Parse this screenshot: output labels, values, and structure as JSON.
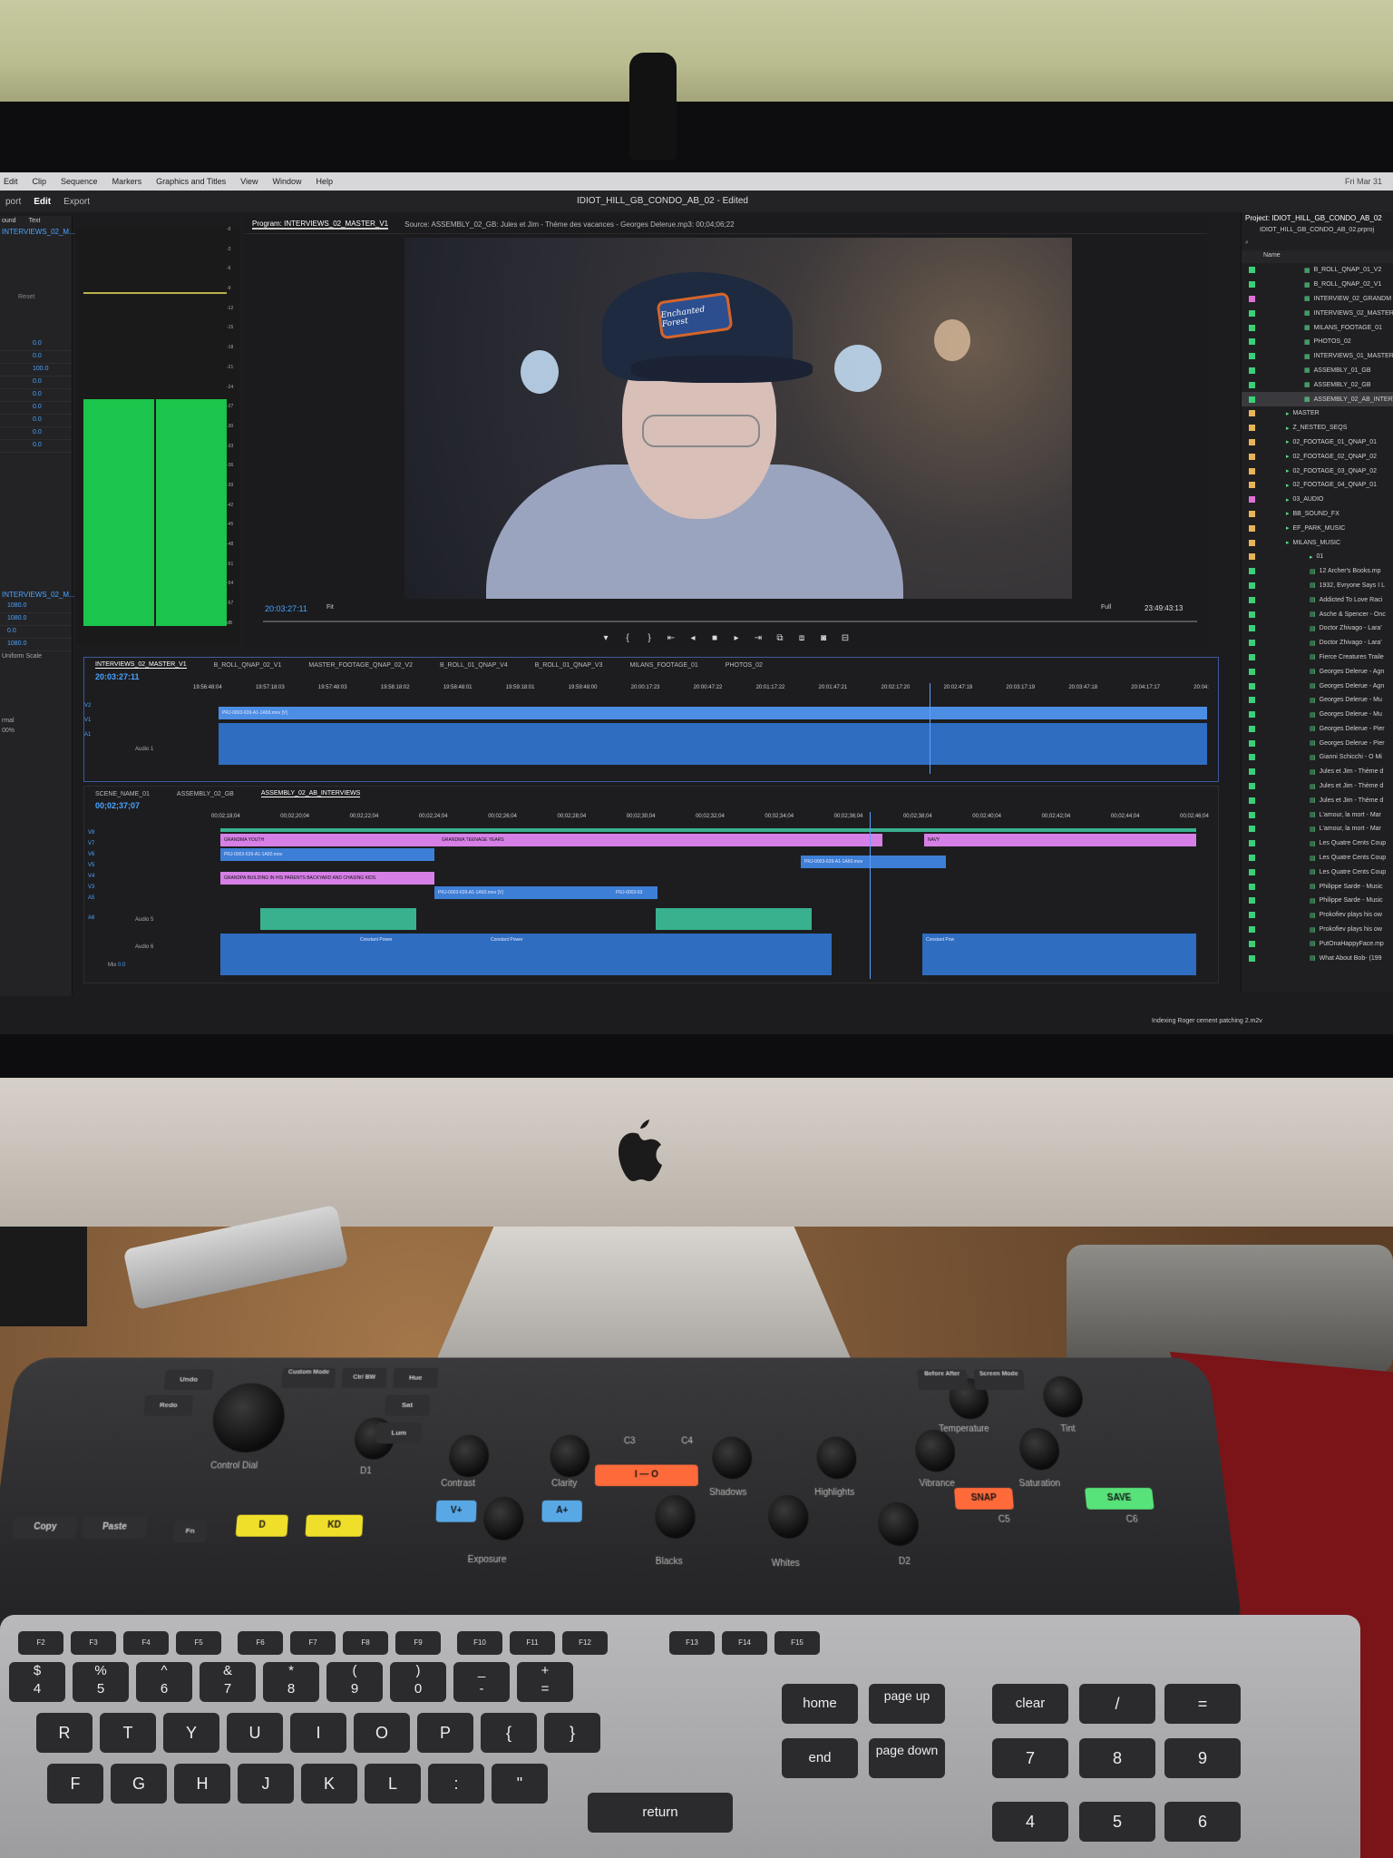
{
  "menu": {
    "items": [
      "Edit",
      "Clip",
      "Sequence",
      "Markers",
      "Graphics and Titles",
      "View",
      "Window",
      "Help"
    ],
    "clock": "Fri Mar 31"
  },
  "workspaces": [
    "port",
    "Edit",
    "Export"
  ],
  "document_title": "IDIOT_HILL_GB_CONDO_AB_02 - Edited",
  "left_panel": {
    "tabs": [
      "ound",
      "Text"
    ],
    "sequence": "INTERVIEWS_02_M...",
    "reset": "Reset",
    "values": [
      "0.0",
      "0.0",
      "100.0",
      "0.0",
      "0.0",
      "0.0",
      "0.0",
      "0.0",
      "0.0"
    ],
    "lower_values": [
      "1080.0",
      "1080.0",
      "0.0",
      "1080.0"
    ],
    "uniform_scale": "Uniform Scale",
    "mode": "rmal",
    "zoom": "00%"
  },
  "meter_scale": [
    "-0",
    "-3",
    "-6",
    "-9",
    "-12",
    "-15",
    "-18",
    "-21",
    "-24",
    "-27",
    "-30",
    "-33",
    "-36",
    "-39",
    "-42",
    "-45",
    "-48",
    "-51",
    "-54",
    "-57",
    "dB"
  ],
  "program": {
    "tab_program": "Program: INTERVIEWS_02_MASTER_V1",
    "tab_source": "Source: ASSEMBLY_02_GB: Jules et Jim - Thème des vacances - Georges Delerue.mp3: 00;04;06;22",
    "timecode_left": "20:03:27:11",
    "fit": "Fit",
    "quality": "Full",
    "timecode_right": "23:49:43:13",
    "cap_logo": "Enchanted Forest"
  },
  "project": {
    "title": "Project: IDIOT_HILL_GB_CONDO_AB_02",
    "file": "IDIOT_HILL_GB_CONDO_AB_02.prproj",
    "column": "Name",
    "items": [
      {
        "label": "B_ROLL_QNAP_01_V2",
        "color": "#3ccf7a"
      },
      {
        "label": "B_ROLL_QNAP_02_V1",
        "color": "#3ccf7a"
      },
      {
        "label": "INTERVIEW_02_GRANDM",
        "color": "#e070d8"
      },
      {
        "label": "INTERVIEWS_02_MASTER",
        "color": "#3ccf7a"
      },
      {
        "label": "MILANS_FOOTAGE_01",
        "color": "#3ccf7a"
      },
      {
        "label": "PHOTOS_02",
        "color": "#3ccf7a"
      },
      {
        "label": "INTERVIEWS_01_MASTER",
        "color": "#3ccf7a"
      },
      {
        "label": "ASSEMBLY_01_GB",
        "color": "#3ccf7a"
      },
      {
        "label": "ASSEMBLY_02_GB",
        "color": "#3ccf7a"
      },
      {
        "label": "ASSEMBLY_02_AB_INTERV",
        "color": "#3ccf7a",
        "selected": true
      },
      {
        "label": "MASTER",
        "color": "#e8b45a"
      },
      {
        "label": "Z_NESTED_SEQS",
        "color": "#e8b45a"
      },
      {
        "label": "02_FOOTAGE_01_QNAP_01",
        "color": "#e8b45a"
      },
      {
        "label": "02_FOOTAGE_02_QNAP_02",
        "color": "#e8b45a"
      },
      {
        "label": "02_FOOTAGE_03_QNAP_02",
        "color": "#e8b45a"
      },
      {
        "label": "02_FOOTAGE_04_QNAP_01",
        "color": "#e8b45a"
      },
      {
        "label": "03_AUDIO",
        "color": "#e070d8"
      },
      {
        "label": "BB_SOUND_FX",
        "color": "#e8b45a"
      },
      {
        "label": "EF_PARK_MUSIC",
        "color": "#e8b45a"
      },
      {
        "label": "MILANS_MUSIC",
        "color": "#e8b45a"
      },
      {
        "label": "01",
        "color": "#e8b45a"
      },
      {
        "label": "12 Archer's Books.mp",
        "color": "#3ccf7a"
      },
      {
        "label": "1932, Evryone Says I L",
        "color": "#3ccf7a"
      },
      {
        "label": "Addicted To Love Raci",
        "color": "#3ccf7a"
      },
      {
        "label": "Asche & Spencer - Onc",
        "color": "#3ccf7a"
      },
      {
        "label": "Doctor Zhivago - Lara'",
        "color": "#3ccf7a"
      },
      {
        "label": "Doctor Zhivago - Lara'",
        "color": "#3ccf7a"
      },
      {
        "label": "Fierce Creatures Traile",
        "color": "#3ccf7a"
      },
      {
        "label": "Georges Delerue - Agn",
        "color": "#3ccf7a"
      },
      {
        "label": "Georges Delerue - Agn",
        "color": "#3ccf7a"
      },
      {
        "label": "Georges Delerue - Mu",
        "color": "#3ccf7a"
      },
      {
        "label": "Georges Delerue - Mu",
        "color": "#3ccf7a"
      },
      {
        "label": "Georges Delerue - Pier",
        "color": "#3ccf7a"
      },
      {
        "label": "Georges Delerue - Pier",
        "color": "#3ccf7a"
      },
      {
        "label": "Gianni Schicchi - O Mi",
        "color": "#3ccf7a"
      },
      {
        "label": "Jules et Jim - Thème d",
        "color": "#3ccf7a"
      },
      {
        "label": "Jules et Jim - Thème d",
        "color": "#3ccf7a"
      },
      {
        "label": "Jules et Jim - Thème d",
        "color": "#3ccf7a"
      },
      {
        "label": "L'amour, la mort - Mar",
        "color": "#3ccf7a"
      },
      {
        "label": "L'amour, la mort - Mar",
        "color": "#3ccf7a"
      },
      {
        "label": "Les Quatre Cents Coup",
        "color": "#3ccf7a"
      },
      {
        "label": "Les Quatre Cents Coup",
        "color": "#3ccf7a"
      },
      {
        "label": "Les Quatre Cents Coup",
        "color": "#3ccf7a"
      },
      {
        "label": "Philippe Sarde - Music",
        "color": "#3ccf7a"
      },
      {
        "label": "Philippe Sarde - Music",
        "color": "#3ccf7a"
      },
      {
        "label": "Prokofiev plays his ow",
        "color": "#3ccf7a"
      },
      {
        "label": "Prokofiev plays his ow",
        "color": "#3ccf7a"
      },
      {
        "label": "PutOnaHappyFace.mp",
        "color": "#3ccf7a"
      },
      {
        "label": "What About Bob- (199",
        "color": "#3ccf7a"
      }
    ]
  },
  "timeline1": {
    "tabs": [
      "INTERVIEWS_02_MASTER_V1",
      "B_ROLL_QNAP_02_V1",
      "MASTER_FOOTAGE_QNAP_02_V2",
      "B_ROLL_01_QNAP_V4",
      "B_ROLL_01_QNAP_V3",
      "MILANS_FOOTAGE_01",
      "PHOTOS_02"
    ],
    "timecode": "20:03:27:11",
    "ruler": [
      "19:56:48:04",
      "19:57:18:03",
      "19:57:48:03",
      "19:58:18:02",
      "19:58:48:01",
      "19:59:18:01",
      "19:59:48:00",
      "20:00:17:23",
      "20:00:47:22",
      "20:01:17:22",
      "20:01:47:21",
      "20:02:17:20",
      "20:02:47:19",
      "20:03:17:19",
      "20:03:47:18",
      "20:04:17:17",
      "20:04:"
    ],
    "tracks": [
      "V2",
      "V1",
      "A1"
    ],
    "audio_label": "Audio 1",
    "clip_label": "PRJ-0003-639-A1-1A50.mov [V]"
  },
  "timeline2": {
    "tabs": [
      "SCENE_NAME_01",
      "ASSEMBLY_02_GB",
      "ASSEMBLY_02_AB_INTERVIEWS"
    ],
    "timecode": "00;02;37;07",
    "ruler": [
      "00;02;18;04",
      "00;02;20;04",
      "00;02;22;04",
      "00;02;24;04",
      "00;02;26;04",
      "00;02;28;04",
      "00;02;30;04",
      "00;02;32;04",
      "00;02;34;04",
      "00;02;36;04",
      "00;02;38;04",
      "00;02;40;04",
      "00;02;42;04",
      "00;02;44;04",
      "00;02;46;04"
    ],
    "tracks": [
      "V8",
      "V7",
      "V6",
      "V5",
      "V4",
      "V3",
      "A5",
      "A6"
    ],
    "clips": {
      "grandma_youth": "GRANDMA YOUTH",
      "grandma_teenage": "GRANDMA TEENAGE YEARS",
      "navy": "NAVY",
      "grandpa": "GRANDPA BUILDING IN HIS PARENTS BACKYARD AND CHASING KIDS",
      "prj1": "PRJ-0003-639-A1-1A50.mov",
      "prj2": "PRJ-0003-639-A1-1A50.mov [V]",
      "prj3": "PRJ-0003-639-A1-1A50.mov",
      "prj4": "PRJ-0003-63",
      "constant_power": "Constant Power",
      "constant_pow": "Constant Pow"
    },
    "audio_label": "Audio 6",
    "audio5": "Audio 5",
    "mix": "Mix",
    "mix_value": "0.0"
  },
  "status": "Indexing Roger cement patching 2.m2v",
  "console": {
    "labels": {
      "control_dial": "Control Dial",
      "d1": "D1",
      "d2": "D2",
      "contrast": "Contrast",
      "clarity": "Clarity",
      "shadows": "Shadows",
      "highlights": "Highlights",
      "vibrance": "Vibrance",
      "saturation": "Saturation",
      "exposure": "Exposure",
      "blacks": "Blacks",
      "whites": "Whites",
      "temperature": "Temperature",
      "tint": "Tint",
      "c3": "C3",
      "c4": "C4",
      "c5": "C5",
      "c6": "C6",
      "undo": "Undo",
      "redo": "Redo",
      "custom_mode": "Custom Mode",
      "clr_bw": "Clr/ BW",
      "hue": "Hue",
      "sat": "Sat",
      "lum": "Lum",
      "before_after": "Before After",
      "screen_mode": "Screen Mode",
      "copy": "Copy",
      "paste": "Paste",
      "fn": "Fn"
    },
    "keys": {
      "snap": "SNAP",
      "save": "SAVE",
      "io": "I — O",
      "vplus": "V+",
      "aplus": "A+",
      "d": "D",
      "kd": "KD"
    }
  },
  "keyboard": {
    "fn_row": [
      "F2",
      "F3",
      "F4",
      "F5",
      "F6",
      "F7",
      "F8",
      "F9",
      "F10",
      "F11",
      "F12",
      "F13",
      "F14",
      "F15"
    ],
    "row1": [
      "$",
      "%",
      "^",
      "&",
      "*",
      "(",
      ")",
      "_",
      "+"
    ],
    "row1_lower": [
      "4",
      "5",
      "6",
      "7",
      "8",
      "9",
      "0",
      "-",
      "="
    ],
    "row2": [
      "R",
      "T",
      "Y",
      "U",
      "I",
      "O",
      "P",
      "{",
      "}"
    ],
    "row3": [
      "F",
      "G",
      "H",
      "J",
      "K",
      "L",
      ":",
      "\""
    ],
    "special": [
      "home",
      "page up",
      "clear",
      "end",
      "page down",
      "return"
    ],
    "numpad": [
      "/",
      "=",
      "7",
      "8",
      "9",
      "4",
      "5",
      "6"
    ]
  }
}
